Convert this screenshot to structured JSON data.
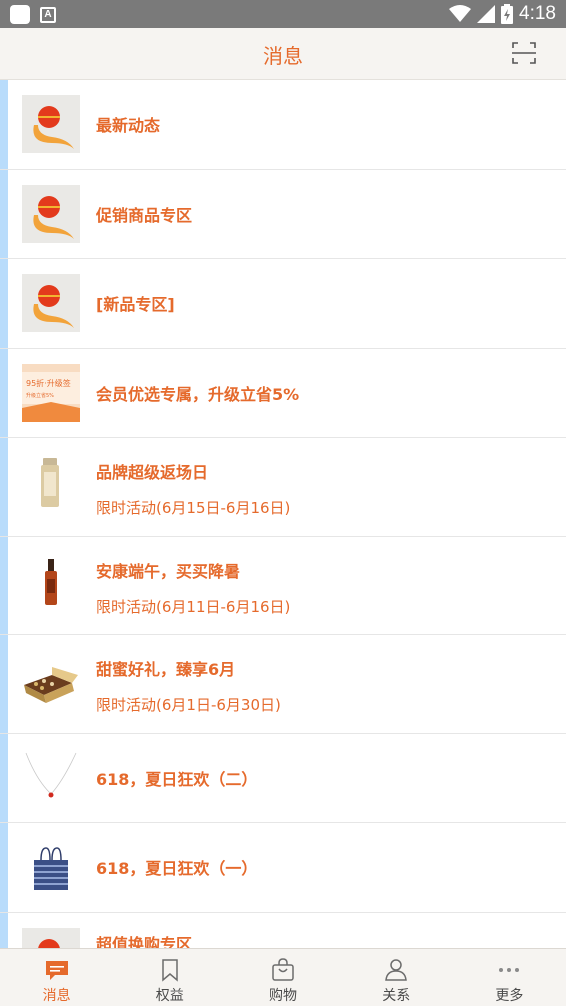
{
  "status_bar": {
    "time": "4:18"
  },
  "header": {
    "title": "消息"
  },
  "items": [
    {
      "title": "最新动态",
      "icon": "brand-logo"
    },
    {
      "title": "促销商品专区",
      "icon": "brand-logo"
    },
    {
      "title": "[新品专区]",
      "icon": "brand-logo"
    },
    {
      "title": "会员优选专属，升级立省5%",
      "icon": "promo-banner",
      "banner_text": "95折·升级签",
      "banner_sub": "升级立省5%"
    },
    {
      "title": "品牌超级返场日",
      "subtitle": "限时活动(6月15日-6月16日)",
      "icon": "sunscreen-bottle"
    },
    {
      "title": "安康端午，买买降暑",
      "subtitle": "限时活动(6月11日-6月16日)",
      "icon": "serum-bottle"
    },
    {
      "title": "甜蜜好礼，臻享6月",
      "subtitle": "限时活动(6月1日-6月30日)",
      "icon": "chocolate-box"
    },
    {
      "title": "618，夏日狂欢（二）",
      "icon": "necklace"
    },
    {
      "title": "618，夏日狂欢（一）",
      "icon": "tote-bag"
    },
    {
      "title": "超值换购专区",
      "icon": "brand-logo"
    }
  ],
  "tabs": [
    {
      "label": "消息",
      "icon": "chat-icon",
      "active": true
    },
    {
      "label": "权益",
      "icon": "bookmark-icon"
    },
    {
      "label": "购物",
      "icon": "shopping-bag-icon"
    },
    {
      "label": "关系",
      "icon": "person-icon"
    },
    {
      "label": "更多",
      "icon": "more-icon"
    }
  ],
  "colors": {
    "accent": "#e56a2c",
    "unread_bar": "#b9dcfb",
    "header_bg": "#f6f4f1"
  }
}
